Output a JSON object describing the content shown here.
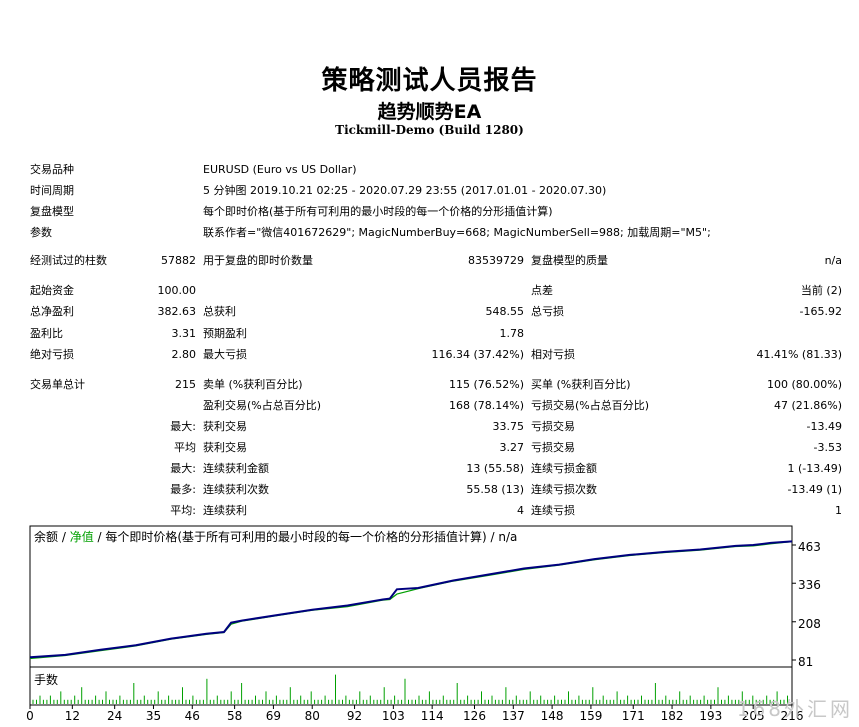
{
  "header": {
    "title": "策略测试人员报告",
    "subtitle": "趋势顺势EA",
    "build": "Tickmill-Demo (Build 1280)"
  },
  "info": [
    {
      "label": "交易品种",
      "value": "EURUSD (Euro vs US Dollar)"
    },
    {
      "label": "时间周期",
      "value": "5 分钟图 2019.10.21 02:25 - 2020.07.29 23:55 (2017.01.01 - 2020.07.30)"
    },
    {
      "label": "复盘模型",
      "value": "每个即时价格(基于所有可利用的最小时段的每一个价格的分形插值计算)"
    },
    {
      "label": "参数",
      "value": "联系作者=\"微信401672629\"; MagicNumberBuy=668; MagicNumberSell=988; 加载周期=\"M5\";"
    }
  ],
  "bars": {
    "label": "经测试过的柱数",
    "value": "57882",
    "ticks_label": "用于复盘的即时价数量",
    "ticks_value": "83539729",
    "quality_label": "复盘模型的质量",
    "quality_value": "n/a"
  },
  "stats_rows": [
    [
      "起始资金",
      "100.00",
      "",
      "",
      "点差",
      "当前 (2)"
    ],
    [
      "总净盈利",
      "382.63",
      "总获利",
      "548.55",
      "总亏损",
      "-165.92"
    ],
    [
      "盈利比",
      "3.31",
      "预期盈利",
      "1.78",
      "",
      ""
    ],
    [
      "绝对亏损",
      "2.80",
      "最大亏损",
      "116.34 (37.42%)",
      "相对亏损",
      "41.41% (81.33)"
    ]
  ],
  "trade_rows": [
    [
      "交易单总计",
      "215",
      "卖单 (%获利百分比)",
      "115 (76.52%)",
      "买单 (%获利百分比)",
      "100 (80.00%)"
    ],
    [
      "",
      "",
      "盈利交易(%占总百分比)",
      "168 (78.14%)",
      "亏损交易(%占总百分比)",
      "47 (21.86%)"
    ],
    [
      "",
      "最大:",
      "获利交易",
      "33.75",
      "亏损交易",
      "-13.49"
    ],
    [
      "",
      "平均",
      "获利交易",
      "3.27",
      "亏损交易",
      "-3.53"
    ],
    [
      "",
      "最大:",
      "连续获利金额",
      "13 (55.58)",
      "连续亏损金额",
      "1 (-13.49)"
    ],
    [
      "",
      "最多:",
      "连续获利次数",
      "55.58 (13)",
      "连续亏损次数",
      "-13.49 (1)"
    ],
    [
      "",
      "平均:",
      "连续获利",
      "4",
      "连续亏损",
      "1"
    ]
  ],
  "chart_legend": {
    "balance": "余额",
    "sep1": " / ",
    "equity": "净值",
    "rest": " / 每个即时价格(基于所有可利用的最小时段的每一个价格的分形插值计算) / n/a"
  },
  "volume_label": "手数",
  "watermark": "168外汇网",
  "colors": {
    "balance": "#00007f",
    "equity": "#00a000",
    "volume": "#00a000"
  },
  "chart_data": {
    "type": "line",
    "x_ticks": [
      "0",
      "12",
      "24",
      "35",
      "46",
      "58",
      "69",
      "80",
      "92",
      "103",
      "114",
      "126",
      "137",
      "148",
      "159",
      "171",
      "182",
      "193",
      "205",
      "216"
    ],
    "y_ticks": [
      "463",
      "336",
      "208",
      "81"
    ],
    "ylim": [
      81,
      463
    ],
    "xlim": [
      0,
      216
    ],
    "series": [
      {
        "name": "余额",
        "x": [
          0,
          10,
          20,
          30,
          40,
          50,
          55,
          57,
          60,
          70,
          80,
          90,
          100,
          102,
          104,
          110,
          120,
          130,
          135,
          140,
          150,
          160,
          170,
          180,
          190,
          200,
          205,
          210,
          216
        ],
        "values": [
          90,
          98,
          115,
          130,
          152,
          168,
          174,
          205,
          212,
          230,
          248,
          262,
          282,
          285,
          316,
          320,
          345,
          365,
          375,
          385,
          398,
          416,
          430,
          440,
          448,
          460,
          463,
          470,
          475
        ]
      },
      {
        "name": "净值",
        "x": [
          0,
          10,
          20,
          30,
          40,
          50,
          55,
          57,
          60,
          70,
          80,
          90,
          100,
          102,
          104,
          110,
          120,
          130,
          135,
          140,
          150,
          160,
          170,
          180,
          190,
          200,
          205,
          210,
          216
        ],
        "values": [
          86,
          96,
          112,
          128,
          150,
          166,
          172,
          200,
          210,
          228,
          246,
          258,
          280,
          282,
          300,
          318,
          343,
          362,
          372,
          382,
          396,
          414,
          428,
          438,
          446,
          458,
          460,
          467,
          474
        ]
      }
    ],
    "volume": {
      "name": "手数",
      "values": [
        1,
        1,
        2,
        1,
        1,
        2,
        1,
        1,
        3,
        1,
        1,
        1,
        2,
        1,
        4,
        1,
        1,
        1,
        2,
        1,
        1,
        3,
        1,
        1,
        1,
        2,
        1,
        1,
        1,
        5,
        1,
        1,
        2,
        1,
        1,
        1,
        3,
        1,
        1,
        2,
        1,
        1,
        1,
        4,
        1,
        1,
        2,
        1,
        1,
        1,
        6,
        1,
        1,
        2,
        1,
        1,
        1,
        3,
        1,
        1,
        5,
        1,
        1,
        1,
        2,
        1,
        1,
        3,
        1,
        1,
        2,
        1,
        1,
        1,
        4,
        1,
        1,
        2,
        1,
        1,
        3,
        1,
        1,
        1,
        2,
        1,
        1,
        7,
        1,
        1,
        2,
        1,
        1,
        1,
        3,
        1,
        1,
        2,
        1,
        1,
        1,
        4,
        1,
        1,
        2,
        1,
        1,
        6,
        1,
        1,
        1,
        2,
        1,
        1,
        3,
        1,
        1,
        1,
        2,
        1,
        1,
        1,
        5,
        1,
        1,
        2,
        1,
        1,
        1,
        3,
        1,
        1,
        2,
        1,
        1,
        1,
        4,
        1,
        1,
        2,
        1,
        1,
        1,
        3,
        1,
        1,
        2,
        1,
        1,
        1,
        2,
        1,
        1,
        1,
        3,
        1,
        1,
        2,
        1,
        1,
        1,
        4,
        1,
        1,
        2,
        1,
        1,
        1,
        3,
        1,
        1,
        2,
        1,
        1,
        1,
        2,
        1,
        1,
        1,
        5,
        1,
        1,
        2,
        1,
        1,
        1,
        3,
        1,
        1,
        2,
        1,
        1,
        1,
        2,
        1,
        1,
        1,
        4,
        1,
        1,
        2,
        1,
        1,
        1,
        3,
        1,
        1,
        2,
        1,
        1,
        1,
        2,
        1,
        1,
        3,
        1,
        1,
        2
      ]
    }
  }
}
